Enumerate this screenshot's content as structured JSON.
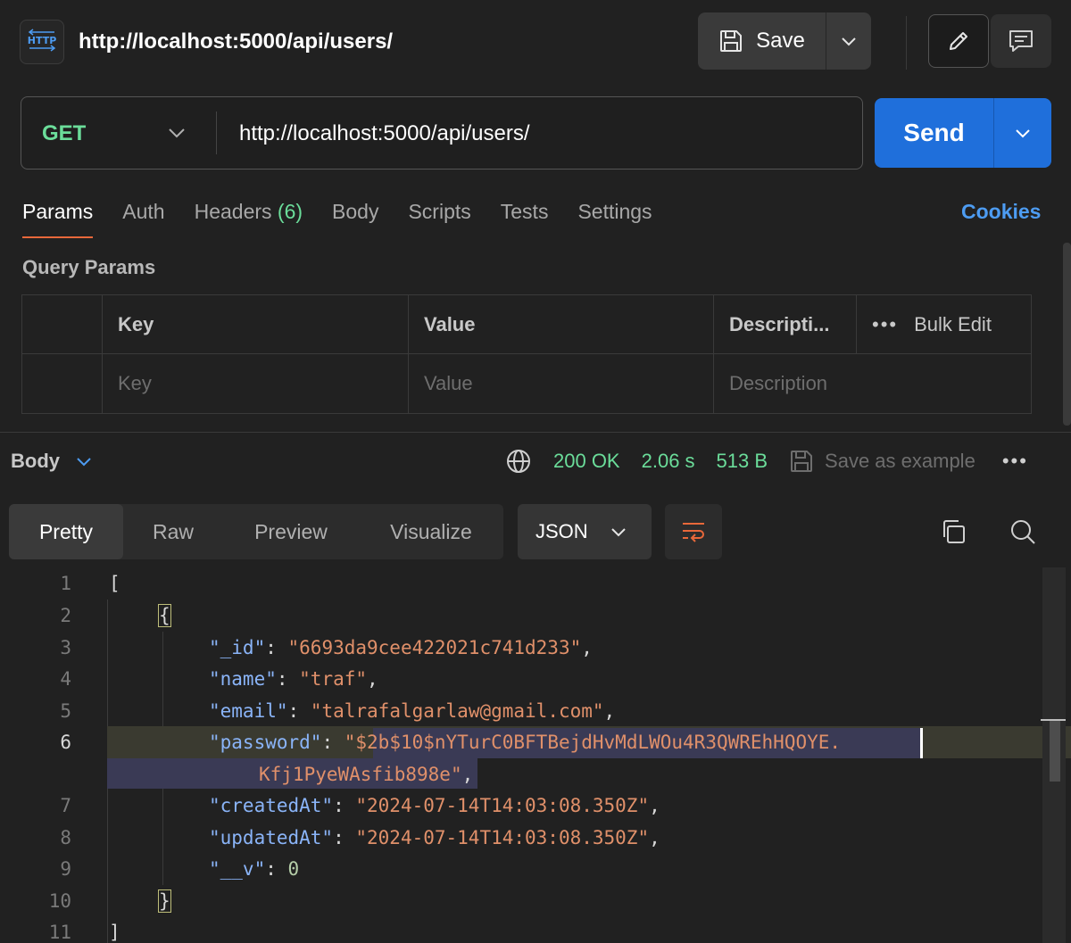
{
  "request": {
    "icon_label": "HTTP",
    "title": "http://localhost:5000/api/users/",
    "save_label": "Save",
    "method": "GET",
    "url": "http://localhost:5000/api/users/",
    "send_label": "Send"
  },
  "request_tabs": {
    "params": "Params",
    "auth": "Auth",
    "headers": "Headers",
    "headers_count": "(6)",
    "body": "Body",
    "scripts": "Scripts",
    "tests": "Tests",
    "settings": "Settings",
    "cookies": "Cookies"
  },
  "query_params": {
    "title": "Query Params",
    "columns": {
      "key": "Key",
      "value": "Value",
      "description": "Descripti...",
      "bulk_edit": "Bulk Edit"
    },
    "row_placeholders": {
      "key": "Key",
      "value": "Value",
      "description": "Description"
    }
  },
  "response": {
    "body_label": "Body",
    "status": "200 OK",
    "time": "2.06 s",
    "size": "513 B",
    "save_example": "Save as example",
    "view_tabs": [
      "Pretty",
      "Raw",
      "Preview",
      "Visualize"
    ],
    "format": "JSON"
  },
  "code": {
    "line_numbers": [
      "1",
      "2",
      "3",
      "4",
      "5",
      "6",
      "7",
      "8",
      "9",
      "10",
      "11"
    ],
    "open_bracket": "[",
    "open_brace": "{",
    "id_key": "\"_id\"",
    "id_val": "\"6693da9cee422021c741d233\"",
    "name_key": "\"name\"",
    "name_val": "\"traf\"",
    "email_key": "\"email\"",
    "email_val": "\"talrafalgarlaw@gmail.com\"",
    "password_key": "\"password\"",
    "password_quote": "\"",
    "password_val_part1": "$2b$10$nYTurC0BFTBejdHvMdLWOu4R3QWREhHQOYE.",
    "password_val_part2": "Kfj1PyeWAsfib898e",
    "created_key": "\"createdAt\"",
    "created_val": "\"2024-07-14T14:03:08.350Z\"",
    "updated_key": "\"updatedAt\"",
    "updated_val": "\"2024-07-14T14:03:08.350Z\"",
    "v_key": "\"__v\"",
    "v_val": "0",
    "close_brace": "}",
    "close_bracket": "]"
  },
  "colors": {
    "accent_blue": "#1f6fdb",
    "status_green": "#6bdd9a",
    "active_tab_orange": "#e8683a",
    "cookies_link": "#4d9cf2"
  }
}
